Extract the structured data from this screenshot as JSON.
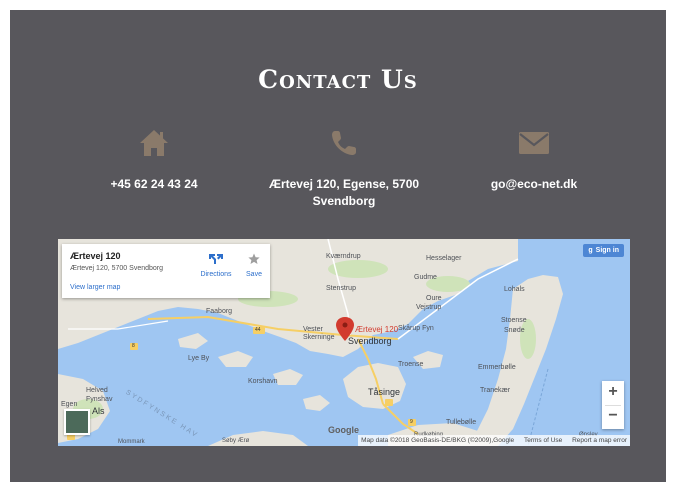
{
  "page": {
    "title": "Contact Us",
    "bg_color": "#58575c",
    "icon_color": "#8a7a6a"
  },
  "contacts": [
    {
      "icon": "home-icon",
      "text": "+45 62 24 43 24"
    },
    {
      "icon": "phone-icon",
      "text": "Ærtevej 120, Egense, 5700 Svendborg"
    },
    {
      "icon": "envelope-icon",
      "text": "go@eco-net.dk"
    }
  ],
  "map": {
    "infobox": {
      "name": "Ærtevej 120",
      "address": "Ærtevej 120, 5700 Svendborg",
      "directions_label": "Directions",
      "save_label": "Save",
      "larger_map_label": "View larger map"
    },
    "sign_in_label": "Sign in",
    "marker_label": "Ærtevej 120",
    "places": {
      "kvaerndrup": "Kværndrup",
      "hesselager": "Hesselager",
      "gudme": "Gudme",
      "stenstrup": "Stenstrup",
      "oure": "Oure",
      "vejstrup": "Vejstrup",
      "lohals": "Lohals",
      "faaborg": "Faaborg",
      "vester_skerninge": "Vester Skerninge",
      "svendborg": "Svendborg",
      "skarup_fyn": "Skårup Fyn",
      "stoense": "Stoense",
      "snode": "Snøde",
      "lye_by": "Lye By",
      "troense": "Troense",
      "emmerbolle": "Emmerbølle",
      "korshavn": "Korshavn",
      "tasinge": "Tåsinge",
      "tranekaer": "Tranekær",
      "helved": "Helved",
      "fynshav": "Fynshav",
      "egen": "Egen",
      "als": "Als",
      "tullebolle": "Tullebølle",
      "rudkobing": "Rudkøbing",
      "onslev": "Ønslev",
      "sydfynske_hav": "SYDFYNSKE HAV",
      "mommark": "Mommark",
      "saby_aero": "Søby Ærø",
      "road_44": "44",
      "road_8": "8",
      "road_9": "9"
    },
    "google_logo": "Google",
    "footer": {
      "data": "Map data ©2018 GeoBasis-DE/BKG (©2009),Google",
      "terms": "Terms of Use",
      "report": "Report a map error"
    },
    "zoom_in": "+",
    "zoom_out": "−"
  }
}
